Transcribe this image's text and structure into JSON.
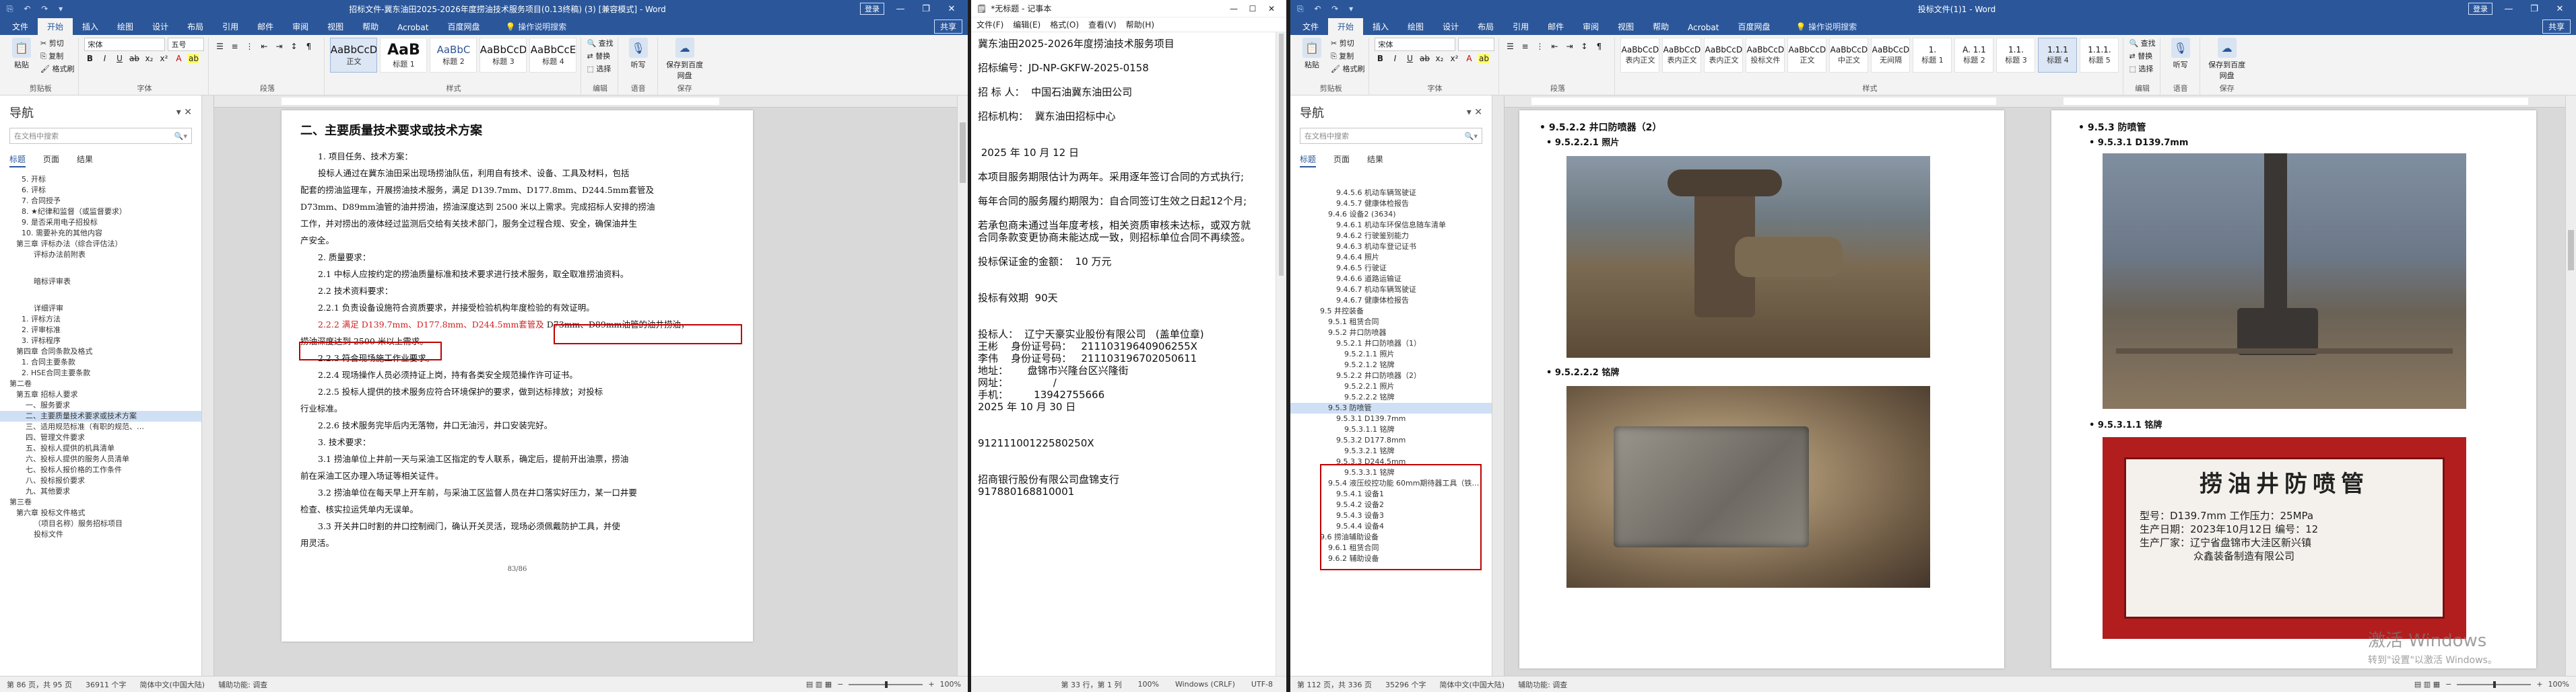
{
  "word1": {
    "qat": "⎘ ↶ ↷ ▾",
    "title": "招标文件-冀东油田2025-2026年度捞油技术服务项目(0.13终稿) (3) [兼容模式] - Word",
    "login": "登录",
    "share": "共享",
    "tabs": [
      "文件",
      "开始",
      "插入",
      "绘图",
      "设计",
      "布局",
      "引用",
      "邮件",
      "审阅",
      "视图",
      "帮助",
      "Acrobat",
      "百度网盘"
    ],
    "search_tab": "操作说明搜索",
    "ribbon": {
      "paste": "粘贴",
      "cut": "剪切",
      "copy": "复制",
      "format_painter": "格式刷",
      "clipboard": "剪贴板",
      "font_name": "宋体",
      "font_size": "五号",
      "font_group": "字体",
      "paragraph": "段落",
      "styles_group": "样式",
      "find": "查找",
      "replace": "替换",
      "select": "选择",
      "editing": "编辑",
      "dictation": "听写",
      "voice": "语音",
      "save_baidu": "保存到百度网盘",
      "save": "保存"
    },
    "styles": [
      {
        "sample": "AaBbCcD",
        "name": "正文"
      },
      {
        "sample": "AaB",
        "name": "标题 1"
      },
      {
        "sample": "AaBbC",
        "name": "标题 2"
      },
      {
        "sample": "AaBbCcD",
        "name": "标题 3"
      },
      {
        "sample": "AaBbCcE",
        "name": "标题 4"
      }
    ],
    "nav": {
      "title": "导航",
      "search_placeholder": "在文档中搜索",
      "tabs": [
        "标题",
        "页面",
        "结果"
      ],
      "items": [
        "5. 开标",
        "6. 评标",
        "7. 合同授予",
        "8. ★纪律和监督（或监督要求）",
        "9. 是否采用电子招投标",
        "10. 需要补充的其他内容",
        "第三章 评标办法（综合评估法）",
        "评标办法前附表",
        "",
        "",
        "暗标评审表",
        "",
        "",
        "详细评审",
        "1. 评标方法",
        "2. 评审标准",
        "3. 评标程序",
        "第四章 合同条款及格式",
        "1. 合同主要条款",
        "2. HSE合同主要条款",
        "第二卷",
        "第五章 招标人要求",
        "一、服务要求",
        "二、主要质量技术要求或技术方案",
        "三、适用规范标准（有职的规范、…",
        "四、管理文件要求",
        "五、投标人提供的机具清单",
        "六、投标人提供的服务人员清单",
        "七、投标人报价格的工作条件",
        "八、投标报价要求",
        "九、其他要求",
        "第三卷",
        "第六章 投标文件格式",
        "（项目名称）服务招标项目",
        "投标文件"
      ],
      "selected_index": 23
    },
    "doc": {
      "heading": "二、主要质量技术要求或技术方案",
      "lines": [
        {
          "t": "1. 项目任务、技术方案：",
          "i": 1
        },
        {
          "t": "投标人通过在冀东油田采出现场捞油队伍，利用自有技术、设备、工具及材料，包括",
          "i": 1
        },
        {
          "t": "配套的捞油监理车，开展捞油技术服务，满足 D139.7mm、D177.8mm、D244.5mm套管及",
          "i": 0
        },
        {
          "t": "D73mm、D89mm油管的油井捞油，捞油深度达到 2500 米以上需求。完成招标人安排的捞油",
          "i": 0
        },
        {
          "t": "工作，并对捞出的液体经过监测后交给有关技术部门，服务全过程合规、安全，确保油井生",
          "i": 0
        },
        {
          "t": "产安全。",
          "i": 0
        },
        {
          "t": "2. 质量要求：",
          "i": 1
        },
        {
          "t": "2.1 中标人应按约定的捞油质量标准和技术要求进行技术服务，取全取准捞油资料。",
          "i": 1
        },
        {
          "t": "2.2 技术资料要求：",
          "i": 1
        },
        {
          "t": "2.2.1 负责设备设施符合资质要求，并接受检验机构年度检验的有效证明。",
          "i": 1
        }
      ],
      "red_prefix": "2.2.2 满足 D139.7mm、D177.8mm、D244.5mm套管及",
      "red_suffix": " D73mm、D89mm油管的油井捞油，",
      "red_line2": "捞油深度达到 2500 米以上需求。",
      "lines2": [
        {
          "t": "2.2.3 符合现场施工作业要求。",
          "i": 1
        },
        {
          "t": "2.2.4 现场操作人员必须持证上岗，持有各类安全规范操作许可证书。",
          "i": 1
        },
        {
          "t": "2.2.5 投标人提供的技术服务应符合环境保护的要求，做到达标排放；对投标",
          "i": 1
        },
        {
          "t": "行业标准。",
          "i": 0
        },
        {
          "t": "2.2.6 技术服务完毕后内无落物，井口无油污，井口安装完好。",
          "i": 1
        },
        {
          "t": "3. 技术要求：",
          "i": 1
        },
        {
          "t": "3.1 捞油单位上井前一天与采油工区指定的专人联系，确定后，提前开出油票，捞油",
          "i": 1
        },
        {
          "t": "前在采油工区办理入场证等相关证件。",
          "i": 0
        },
        {
          "t": "3.2 捞油单位在每天早上开车前，与采油工区监督人员在井口落实好压力，某一口井要",
          "i": 1
        },
        {
          "t": "检查、核实拉运凭单内无误单。",
          "i": 0
        },
        {
          "t": "3.3 开关井口时割的井口控制阀门，确认开关灵活，现场必须佩戴防护工具，并使",
          "i": 1
        },
        {
          "t": "用灵活。",
          "i": 0
        }
      ],
      "page_number": "83/86"
    },
    "status": {
      "page": "第 86 页，共 95 页",
      "words": "36911 个字",
      "lang": "简体中文(中国大陆)",
      "access": "辅助功能: 调查",
      "zoom": "100%"
    }
  },
  "notepad": {
    "title": "*无标题 - 记事本",
    "menu": [
      "文件(F)",
      "编辑(E)",
      "格式(O)",
      "查看(V)",
      "帮助(H)"
    ],
    "lines": [
      "冀东油田2025-2026年度捞油技术服务项目",
      "",
      "招标编号：JD-NP-GKFW-2025-0158",
      "",
      "招 标 人：  中国石油冀东油田公司",
      "",
      "招标机构：  冀东油田招标中心",
      "",
      "",
      " 2025 年 10 月 12 日",
      "",
      "本项目服务期限估计为两年。采用逐年签订合同的方式执行;",
      "",
      "每年合同的服务履约期限为：自合同签订生效之日起12个月;",
      "",
      "若承包商未通过当年度考核，相关资质审核未达标，或双方就",
      "合同条款变更协商未能达成一致，则招标单位合同不再续签。",
      "",
      "投标保证金的金额：  10 万元",
      "",
      "",
      "投标有效期  90天",
      "",
      "",
      "投标人：  辽宁天豪实业股份有限公司   (盖单位章)",
      "王彬    身份证号码：   21110319640906255X",
      "李伟    身份证号码：   211103196702050611",
      "地址：      盘锦市兴隆台区兴隆街",
      "网址：              /",
      "手机：        13942755666",
      "2025 年 10 月 30 日",
      "",
      "",
      "91211100122580250X",
      "",
      "",
      "招商银行股份有限公司盘锦支行",
      "917880168810001"
    ],
    "status": {
      "pos": "第 33 行，第 1 列",
      "zoom": "100%",
      "eol": "Windows (CRLF)",
      "enc": "UTF-8"
    }
  },
  "word3": {
    "qat": "⎘ ↶ ↷ ▾",
    "title": "投标文件(1)1 - Word",
    "login": "登录",
    "share": "共享",
    "tabs": [
      "文件",
      "开始",
      "插入",
      "绘图",
      "设计",
      "布局",
      "引用",
      "邮件",
      "审阅",
      "视图",
      "帮助",
      "Acrobat",
      "百度网盘"
    ],
    "search_tab": "操作说明搜索",
    "ribbon": {
      "paste": "粘贴",
      "cut": "剪切",
      "copy": "复制",
      "format_painter": "格式刷",
      "clipboard": "剪贴板",
      "font_name": "宋体",
      "font_size": "",
      "font_group": "字体",
      "paragraph": "段落",
      "styles_group": "样式",
      "find": "查找",
      "replace": "替换",
      "select": "选择",
      "editing": "编辑",
      "dictation": "听写",
      "voice": "语音",
      "save_baidu": "保存到百度网盘",
      "save": "保存"
    },
    "styles": [
      {
        "sample": "AaBbCcD",
        "name": "表内正文"
      },
      {
        "sample": "AaBbCcD",
        "name": "表内正文"
      },
      {
        "sample": "AaBbCcD",
        "name": "表内正文"
      },
      {
        "sample": "AaBbCcD",
        "name": "投标文件"
      },
      {
        "sample": "AaBbCcD",
        "name": "正文"
      },
      {
        "sample": "AaBbCcD",
        "name": "中正文"
      },
      {
        "sample": "AaBbCcD",
        "name": "无间隔"
      },
      {
        "sample": "1.",
        "name": "标题 1"
      },
      {
        "sample": "A. 1.1",
        "name": "标题 2"
      },
      {
        "sample": "1.1.",
        "name": "标题 3"
      },
      {
        "sample": "1.1.1",
        "name": "标题 4"
      },
      {
        "sample": "1.1.1.",
        "name": "标题 5"
      }
    ],
    "nav": {
      "title": "导航",
      "search_placeholder": "在文档中搜索",
      "tabs": [
        "标题",
        "页面",
        "结果"
      ],
      "items": [
        "9.4.5.6 机动车辆驾驶证",
        "9.4.5.7 健康体检报告",
        "9.4.6 设备2 (3634)",
        "9.4.6.1 机动车环保信息随车清单",
        "9.4.6.2 行驶鉴别能力",
        "9.4.6.3 机动车登记证书",
        "9.4.6.4 照片",
        "9.4.6.5 行驶证",
        "9.4.6.6 道路运输证",
        "9.4.6.7 机动车辆驾驶证",
        "9.4.6.7 健康体检报告",
        "9.5 井控装备",
        "9.5.1 租赁合同",
        "9.5.2 井口防喷器",
        "9.5.2.1 井口防喷器（1）",
        "9.5.2.1.1 照片",
        "9.5.2.1.2 铭牌",
        "9.5.2.2 井口防喷器（2）",
        "9.5.2.2.1 照片",
        "9.5.2.2.2 铭牌",
        "9.5.3 防喷管",
        "9.5.3.1 D139.7mm",
        "9.5.3.1.1 铭牌",
        "9.5.3.2 D177.8mm",
        "9.5.3.2.1 铭牌",
        "9.5.3.3 D244.5mm",
        "9.5.3.3.1 铭牌",
        "9.5.4 液压绞控功能 60mm期待器工具（铁…",
        "9.5.4.1 设备1",
        "9.5.4.2 设备2",
        "9.5.4.3 设备3",
        "9.5.4.4 设备4",
        "9.6 捞油辅助设备",
        "9.6.1 租赁合同",
        "9.6.2 辅助设备"
      ],
      "selected_index": 20
    },
    "doc": {
      "h_left": "• 9.5.2.2   井口防喷器（2）",
      "sub_left1": "• 9.5.2.2.1   照片",
      "sub_left2": "• 9.5.2.2.2   铭牌",
      "h_right": "• 9.5.3   防喷管",
      "sub_right1": "• 9.5.3.1   D139.7mm",
      "sub_right2": "• 9.5.3.1.1   铭牌",
      "sign_title": "捞油井防喷管",
      "sign_lines": [
        "型号：D139.7mm   工作压力：25MPa",
        "生产日期：2023年10月12日   编号：12",
        "生产厂家：辽宁省盘锦市大洼区新兴镇",
        "众鑫装备制造有限公司"
      ],
      "watermark": "激活 Windows",
      "watermark_small": "转到\"设置\"以激活 Windows。"
    },
    "status": {
      "page": "第 112 页，共 336 页",
      "words": "35296 个字",
      "lang": "简体中文(中国大陆)",
      "access": "辅助功能: 调查",
      "zoom": "100%"
    }
  }
}
